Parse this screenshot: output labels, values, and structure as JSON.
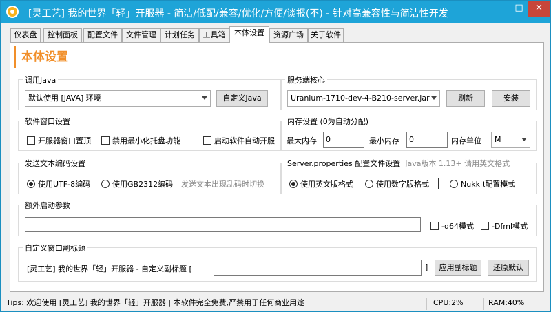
{
  "window": {
    "title": "[灵工艺] 我的世界「轻」开服器 - 简洁/低配/兼容/优化/方便/谈报(不) - 针对高兼容性与简洁性开发",
    "minimize": "—",
    "maximize": "□",
    "close": "✕"
  },
  "tabs": [
    {
      "label": "仪表盘"
    },
    {
      "label": "控制面板"
    },
    {
      "label": "配置文件"
    },
    {
      "label": "文件管理"
    },
    {
      "label": "计划任务"
    },
    {
      "label": "工具箱"
    },
    {
      "label": "本体设置",
      "active": true
    },
    {
      "label": "资源广场"
    },
    {
      "label": "关于软件"
    }
  ],
  "page_title": "本体设置",
  "java": {
    "label": "调用Java",
    "selected": "默认使用 [JAVA] 环境",
    "custom_button": "自定义Java"
  },
  "core": {
    "label": "服务端核心",
    "selected": "Uranium-1710-dev-4-B210-server.jar",
    "refresh_button": "刷新",
    "install_button": "安装"
  },
  "window_settings": {
    "label": "软件窗口设置",
    "options": [
      {
        "label": "开服器窗口置顶",
        "checked": false
      },
      {
        "label": "禁用最小化托盘功能",
        "checked": false
      },
      {
        "label": "启动软件自动开服",
        "checked": false
      }
    ]
  },
  "memory": {
    "label": "内存设置 (0为自动分配)",
    "max_label": "最大内存",
    "max_value": "0",
    "min_label": "最小内存",
    "min_value": "0",
    "unit_label": "内存单位",
    "unit_value": "M"
  },
  "encoding": {
    "label": "发送文本编码设置",
    "options": [
      {
        "label": "使用UTF-8编码",
        "selected": true
      },
      {
        "label": "使用GB2312编码",
        "selected": false
      }
    ],
    "hint": "发送文本出现乱码时切换"
  },
  "properties": {
    "label": "Server.properties 配置文件设置",
    "hint": "Java版本 1.13+ 请用英文格式",
    "options": [
      {
        "label": "使用英文版格式",
        "selected": true
      },
      {
        "label": "使用数字版格式",
        "selected": false
      },
      {
        "label": "Nukkit配置模式",
        "selected": false
      }
    ]
  },
  "extra_args": {
    "label": "额外启动参数",
    "value": "",
    "d64_label": "-d64模式",
    "dfml_label": "-Dfml模式"
  },
  "subtitle": {
    "label": "自定义窗口副标题",
    "prefix": "[灵工艺] 我的世界「轻」开服器 - 自定义副标题 [",
    "value": "",
    "suffix": "]",
    "apply_button": "应用副标题",
    "reset_button": "还原默认"
  },
  "status": {
    "tips": "Tips: 欢迎使用 [灵工艺] 我的世界「轻」开服器 | 本软件完全免费,严禁用于任何商业用途",
    "cpu": "CPU:2%",
    "ram": "RAM:40%"
  }
}
